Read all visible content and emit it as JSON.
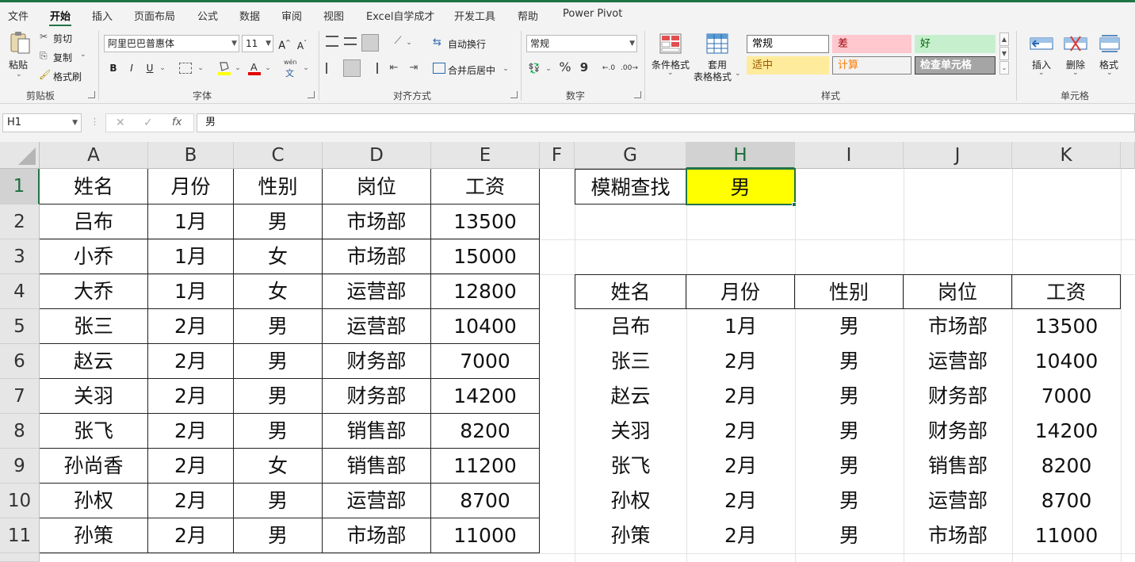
{
  "ribbon_tabs": [
    "文件",
    "开始",
    "插入",
    "页面布局",
    "公式",
    "数据",
    "审阅",
    "视图",
    "Excel自学成才",
    "开发工具",
    "帮助",
    "Power Pivot"
  ],
  "clipboard": {
    "paste": "粘贴",
    "cut": "剪切",
    "copy": "复制",
    "format_painter": "格式刷",
    "group": "剪贴板"
  },
  "font": {
    "name": "阿里巴巴普惠体",
    "size": "11",
    "bold": "B",
    "italic": "I",
    "underline": "U",
    "wen": "wén",
    "wen_char": "文",
    "group": "字体",
    "highlight_color": "#ffff00",
    "font_color": "#e00000"
  },
  "alignment": {
    "wrap": "自动换行",
    "merge": "合并后居中",
    "group": "对齐方式"
  },
  "number": {
    "format": "常规",
    "percent": "%",
    "comma": "9",
    "group": "数字"
  },
  "styles": {
    "cond_format": "条件格式",
    "table_format_1": "套用",
    "table_format_2": "表格格式",
    "cells": [
      {
        "label": "常规",
        "bg": "#ffffff",
        "color": "#000000",
        "border": "#808080"
      },
      {
        "label": "差",
        "bg": "#ffc7ce",
        "color": "#9c0006",
        "border": "#ffc7ce"
      },
      {
        "label": "好",
        "bg": "#c6efce",
        "color": "#006100",
        "border": "#c6efce"
      },
      {
        "label": "适中",
        "bg": "#ffeb9c",
        "color": "#9c5700",
        "border": "#ffeb9c"
      },
      {
        "label": "计算",
        "bg": "#f2f2f2",
        "color": "#fa7d00",
        "border": "#7f7f7f"
      },
      {
        "label": "检查单元格",
        "bg": "#a5a5a5",
        "color": "#ffffff",
        "border": "#3f3f3f"
      }
    ],
    "group": "样式"
  },
  "cells_group": {
    "insert": "插入",
    "delete": "删除",
    "format": "格式",
    "group": "单元格"
  },
  "formula_bar": {
    "name_box": "H1",
    "content": "男"
  },
  "columns": [
    "A",
    "B",
    "C",
    "D",
    "E",
    "F",
    "G",
    "H",
    "I",
    "J",
    "K"
  ],
  "rows": [
    "1",
    "2",
    "3",
    "4",
    "5",
    "6",
    "7",
    "8",
    "9",
    "10",
    "11"
  ],
  "source_table": {
    "headers": [
      "姓名",
      "月份",
      "性别",
      "岗位",
      "工资"
    ],
    "rows": [
      [
        "吕布",
        "1月",
        "男",
        "市场部",
        "13500"
      ],
      [
        "小乔",
        "1月",
        "女",
        "市场部",
        "15000"
      ],
      [
        "大乔",
        "1月",
        "女",
        "运营部",
        "12800"
      ],
      [
        "张三",
        "2月",
        "男",
        "运营部",
        "10400"
      ],
      [
        "赵云",
        "2月",
        "男",
        "财务部",
        "7000"
      ],
      [
        "关羽",
        "2月",
        "男",
        "财务部",
        "14200"
      ],
      [
        "张飞",
        "2月",
        "男",
        "销售部",
        "8200"
      ],
      [
        "孙尚香",
        "2月",
        "女",
        "销售部",
        "11200"
      ],
      [
        "孙权",
        "2月",
        "男",
        "运营部",
        "8700"
      ],
      [
        "孙策",
        "2月",
        "男",
        "市场部",
        "11000"
      ]
    ]
  },
  "lookup": {
    "label": "模糊查找",
    "value": "男",
    "value_bg": "#ffff00"
  },
  "result_table": {
    "headers": [
      "姓名",
      "月份",
      "性别",
      "岗位",
      "工资"
    ],
    "rows": [
      [
        "吕布",
        "1月",
        "男",
        "市场部",
        "13500"
      ],
      [
        "张三",
        "2月",
        "男",
        "运营部",
        "10400"
      ],
      [
        "赵云",
        "2月",
        "男",
        "财务部",
        "7000"
      ],
      [
        "关羽",
        "2月",
        "男",
        "财务部",
        "14200"
      ],
      [
        "张飞",
        "2月",
        "男",
        "销售部",
        "8200"
      ],
      [
        "孙权",
        "2月",
        "男",
        "运营部",
        "8700"
      ],
      [
        "孙策",
        "2月",
        "男",
        "市场部",
        "11000"
      ]
    ]
  }
}
